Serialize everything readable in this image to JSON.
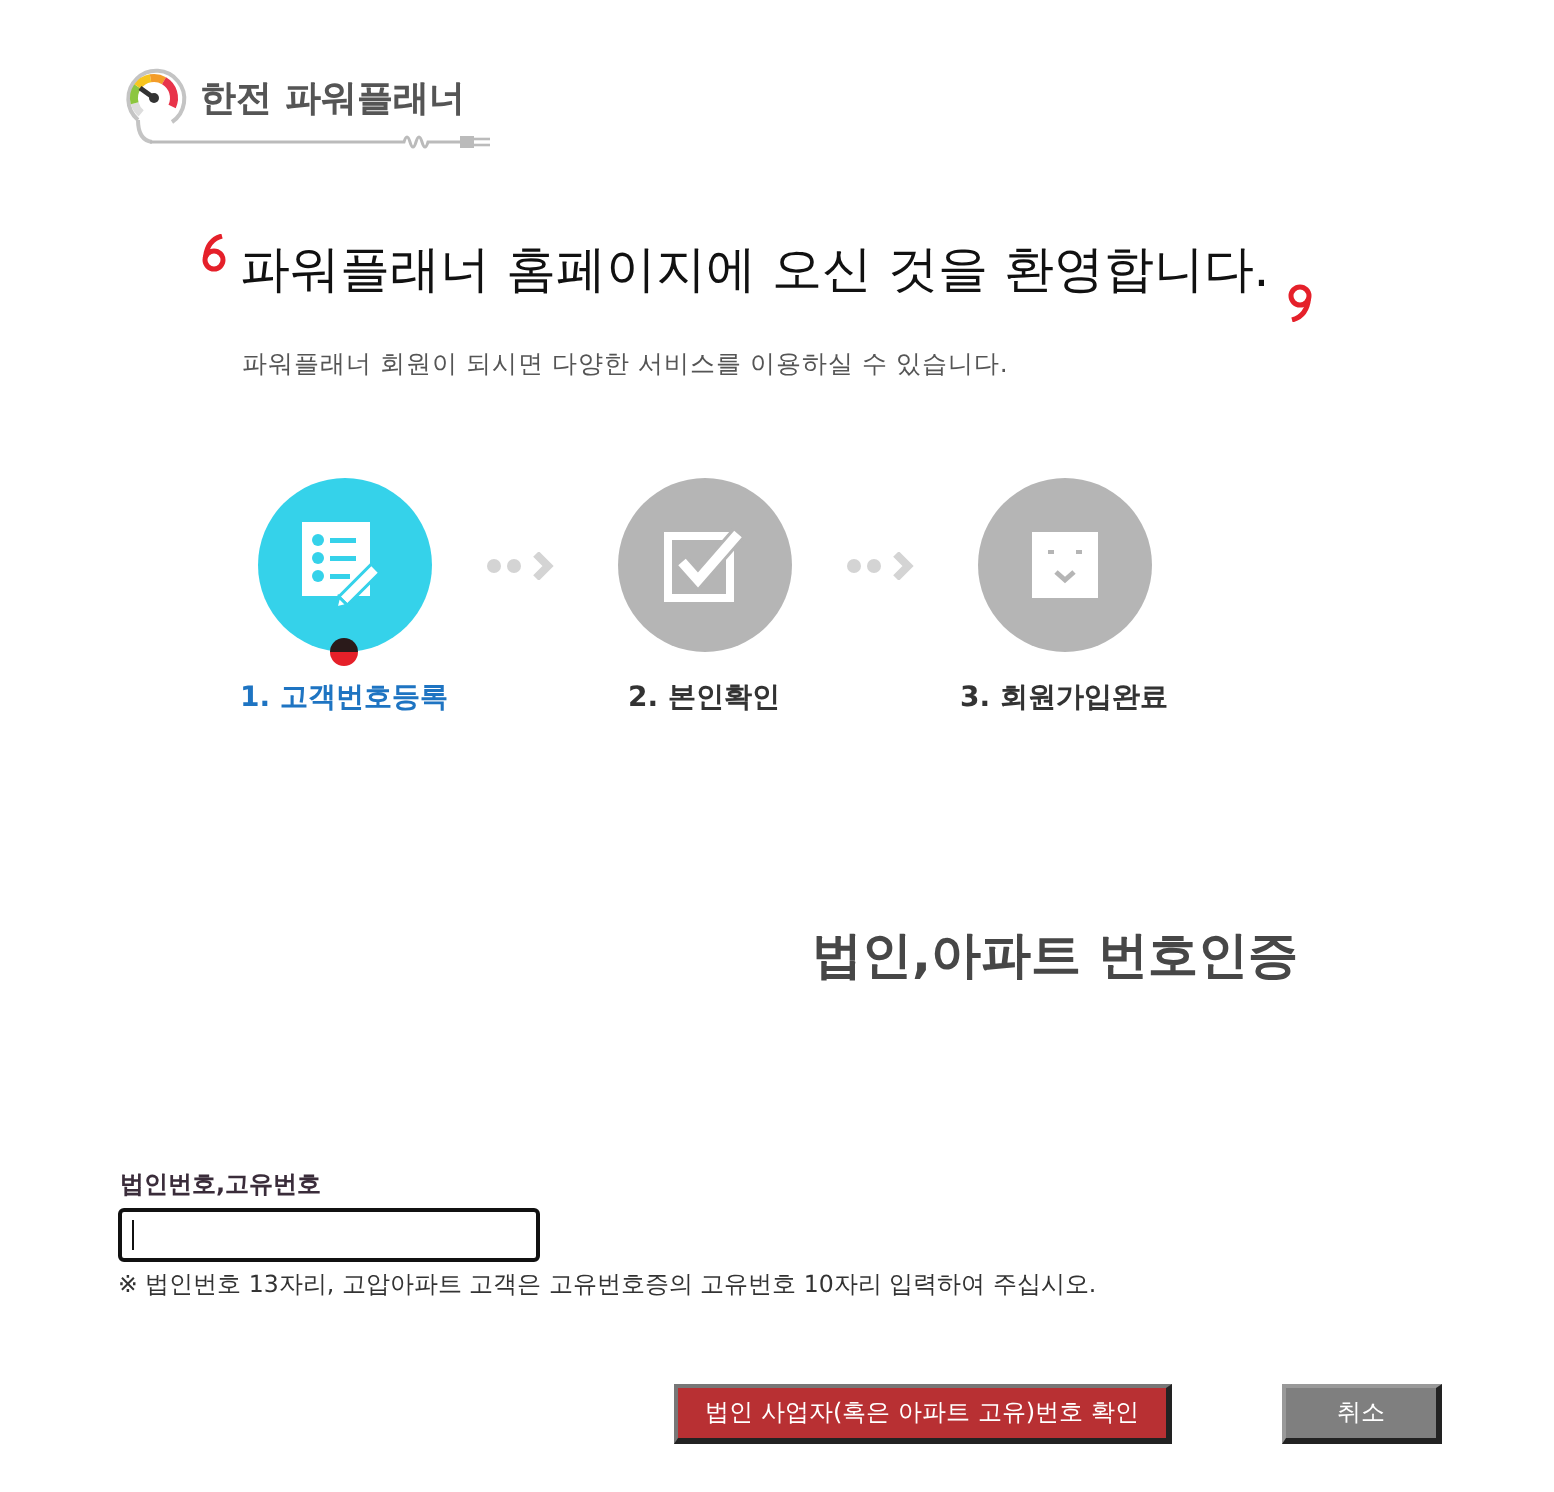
{
  "logo": {
    "text": "한전 파워플래너"
  },
  "welcome": {
    "title": "파워플래너 홈페이지에 오신 것을 환영합니다.",
    "subtitle": "파워플래너 회원이 되시면 다양한 서비스를 이용하실 수 있습니다."
  },
  "steps": [
    {
      "kind": "form",
      "label": "1. 고객번호등록",
      "selected": true
    },
    {
      "kind": "check",
      "label": "2. 본인확인",
      "selected": false
    },
    {
      "kind": "smile",
      "label": "3. 회원가입완료",
      "selected": false
    }
  ],
  "section_title": "법인,아파트 번호인증",
  "field": {
    "label": "법인번호,고유번호",
    "focused": true,
    "note": "※ 법인번호 13자리, 고압아파트 고객은 고유번호증의 고유번호 10자리 입력하여 주십시오."
  },
  "buttons": [
    {
      "kind": "primary",
      "label": "법인 사업자(혹은 아파트 고유)번호 확인"
    },
    {
      "kind": "secondary",
      "label": "취소"
    }
  ]
}
